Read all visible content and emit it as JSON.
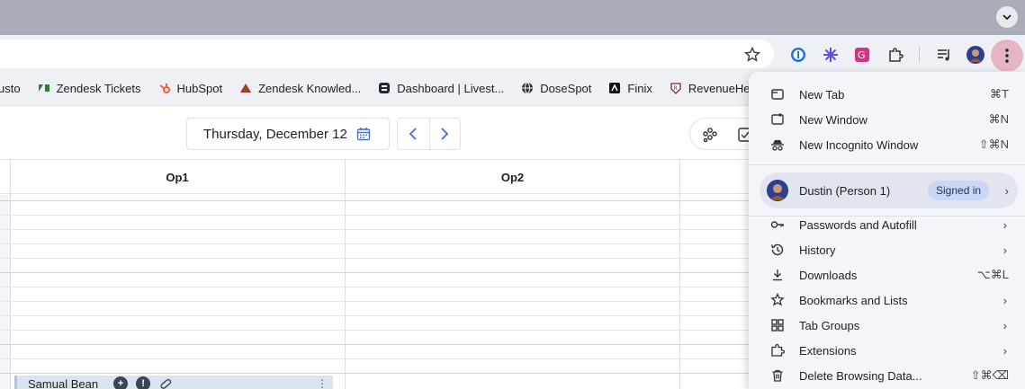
{
  "browser": {
    "bookmarks": [
      {
        "label": "usto",
        "icon": "bookmark-partial-icon"
      },
      {
        "label": "Zendesk Tickets",
        "icon": "zendesk-icon"
      },
      {
        "label": "HubSpot",
        "icon": "hubspot-icon"
      },
      {
        "label": "Zendesk Knowled...",
        "icon": "zendesk-guide-icon"
      },
      {
        "label": "Dashboard | Livest...",
        "icon": "dashboard-icon"
      },
      {
        "label": "DoseSpot",
        "icon": "globe-icon"
      },
      {
        "label": "Finix",
        "icon": "finix-icon"
      },
      {
        "label": "RevenueHero",
        "icon": "revenuehero-icon"
      }
    ]
  },
  "app": {
    "date_label": "Thursday, December 12",
    "columns": [
      "Op1",
      "Op2"
    ],
    "appointment": {
      "patient": "Samual Bean"
    }
  },
  "menu": {
    "items_top": [
      {
        "label": "New Tab",
        "shortcut": "⌘T",
        "icon": "new-tab-icon"
      },
      {
        "label": "New Window",
        "shortcut": "⌘N",
        "icon": "new-window-icon"
      },
      {
        "label": "New Incognito Window",
        "shortcut": "⇧⌘N",
        "icon": "incognito-icon"
      }
    ],
    "profile": {
      "name": "Dustin (Person 1)",
      "status": "Signed in"
    },
    "items_bottom": [
      {
        "label": "Passwords and Autofill",
        "shortcut": "",
        "icon": "key-icon",
        "submenu": true
      },
      {
        "label": "History",
        "shortcut": "",
        "icon": "history-icon",
        "submenu": true
      },
      {
        "label": "Downloads",
        "shortcut": "⌥⌘L",
        "icon": "download-icon",
        "submenu": false
      },
      {
        "label": "Bookmarks and Lists",
        "shortcut": "",
        "icon": "star-icon",
        "submenu": true
      },
      {
        "label": "Tab Groups",
        "shortcut": "",
        "icon": "tab-groups-icon",
        "submenu": true
      },
      {
        "label": "Extensions",
        "shortcut": "",
        "icon": "puzzle-icon",
        "submenu": true
      },
      {
        "label": "Delete Browsing Data...",
        "shortcut": "⇧⌘⌫",
        "icon": "trash-icon",
        "submenu": false
      }
    ]
  }
}
